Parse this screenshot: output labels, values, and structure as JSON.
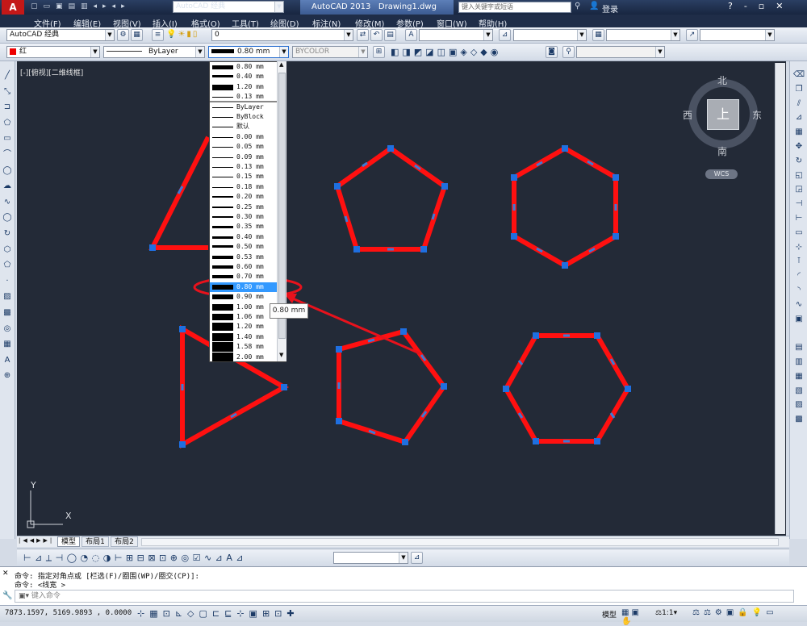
{
  "titlebar": {
    "workspace": "AutoCAD 经典",
    "app": "AutoCAD 2013",
    "file": "Drawing1.dwg",
    "search_placeholder": "键入关键字或短语",
    "login": "登录"
  },
  "menu": [
    "文件(F)",
    "编辑(E)",
    "视图(V)",
    "插入(I)",
    "格式(O)",
    "工具(T)",
    "绘图(D)",
    "标注(N)",
    "修改(M)",
    "参数(P)",
    "窗口(W)",
    "帮助(H)"
  ],
  "toolbar1": {
    "workspace_combo": "AutoCAD 经典",
    "layer_combo": "0"
  },
  "toolbar2": {
    "color": "红",
    "linetype": "ByLayer",
    "lineweight": "0.80 mm",
    "plotstyle": "BYCOLOR"
  },
  "viewport_label": "[-][俯视][二维线框]",
  "lineweight_list": {
    "recent": [
      "0.80 mm",
      "0.40 mm",
      "1.20 mm",
      "0.13 mm"
    ],
    "options": [
      "ByLayer",
      "ByBlock",
      "默认",
      "0.00 mm",
      "0.05 mm",
      "0.09 mm",
      "0.13 mm",
      "0.15 mm",
      "0.18 mm",
      "0.20 mm",
      "0.25 mm",
      "0.30 mm",
      "0.35 mm",
      "0.40 mm",
      "0.50 mm",
      "0.53 mm",
      "0.60 mm",
      "0.70 mm",
      "0.80 mm",
      "0.90 mm",
      "1.00 mm",
      "1.06 mm",
      "1.20 mm",
      "1.40 mm",
      "1.58 mm",
      "2.00 mm"
    ],
    "selected": "0.80 mm"
  },
  "tooltip": "0.80 mm",
  "viewcube": {
    "north": "北",
    "south": "南",
    "east": "东",
    "west": "西",
    "top": "上",
    "wcs": "WCS"
  },
  "ucs": {
    "x": "X",
    "y": "Y"
  },
  "tabs": [
    "模型",
    "布局1",
    "布局2"
  ],
  "command": {
    "line1": "命令: 指定对角点或 [栏选(F)/圈围(WP)/圈交(CP)]:",
    "line2": "命令: <线宽 >",
    "prompt": "键入命令"
  },
  "status": {
    "coords": "7873.1597,  5169.9893 , 0.0000",
    "model": "模型",
    "scale": "1:1"
  },
  "colors": {
    "shape_stroke": "#ff1010",
    "grip": "#1f6fe0",
    "canvas": "#232a37",
    "annotation": "#e8121c"
  }
}
